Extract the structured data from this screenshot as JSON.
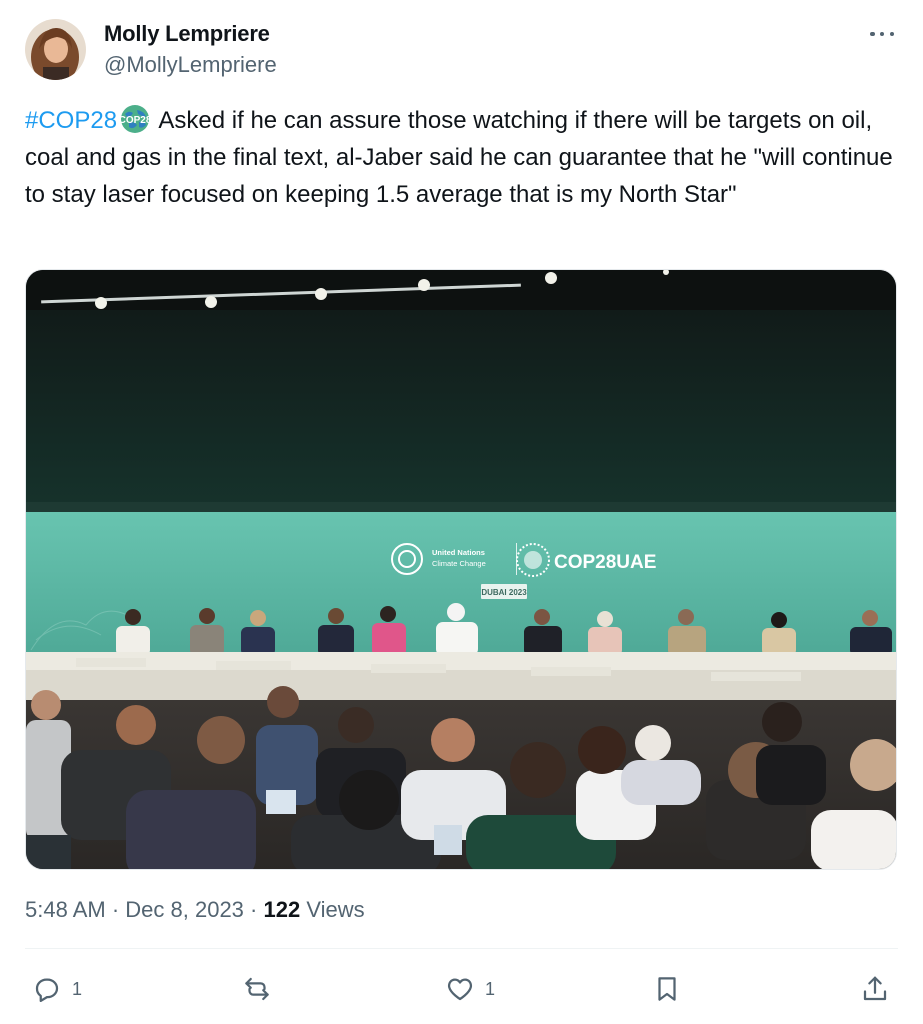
{
  "author": {
    "name": "Molly Lempriere",
    "handle": "@MollyLempriere"
  },
  "tweet": {
    "hashtag": "#COP28",
    "emoji_badge_text": "COP28",
    "body": " Asked if he can assure those watching if there will be targets on oil, coal and gas in the final text, al-Jaber said he can guarantee that he \"will continue to stay laser focused on keeping 1.5 average that is my North Star\""
  },
  "media": {
    "backdrop": {
      "un_logo_line1": "United Nations",
      "un_logo_line2": "Climate Change",
      "cop_logo": "COP28UAE",
      "sub_tag": "DUBAI 2023"
    }
  },
  "meta": {
    "time": "5:48 AM",
    "separator": " · ",
    "date": "Dec 8, 2023",
    "views_count": "122",
    "views_label": " Views"
  },
  "actions": {
    "reply_count": "1",
    "retweet_count": "",
    "like_count": "1"
  },
  "colors": {
    "accent": "#1d9bf0",
    "text": "#0f1419",
    "secondary": "#536471",
    "stage_green": "#5fb8a4"
  },
  "icons": [
    "more-icon",
    "reply-icon",
    "retweet-icon",
    "like-icon",
    "bookmark-icon",
    "share-icon",
    "cop28-globe-icon"
  ]
}
